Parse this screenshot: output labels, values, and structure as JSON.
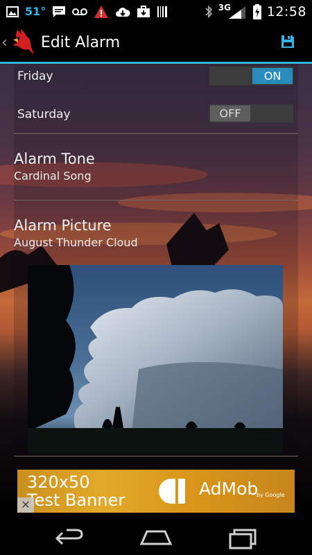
{
  "status_bar": {
    "temperature": "51°",
    "network": "3G",
    "time": "12:58",
    "icons": [
      "image-icon",
      "chat-icon",
      "voicemail-icon",
      "warning-icon",
      "cloud-download-icon",
      "briefcase-icon",
      "barcode-icon",
      "bluetooth-icon",
      "signal-icon",
      "battery-icon"
    ]
  },
  "action_bar": {
    "title": "Edit Alarm",
    "back_icon": "chevron-left-icon",
    "app_icon": "cardinal-bird-icon",
    "save_icon": "floppy-save-icon",
    "accent_color": "#33b5e5"
  },
  "days": [
    {
      "label": "Friday",
      "state": "ON"
    },
    {
      "label": "Saturday",
      "state": "OFF"
    }
  ],
  "alarm_tone": {
    "title": "Alarm Tone",
    "value": "Cardinal Song"
  },
  "alarm_picture": {
    "title": "Alarm Picture",
    "value": "August Thunder Cloud"
  },
  "ad_banner": {
    "text_line1": "320x50",
    "text_line2": "Test Banner",
    "brand": "AdMob",
    "brand_by": "by Google",
    "close": "✕"
  },
  "nav_bar": {
    "icons": [
      "back-icon",
      "home-icon",
      "recent-apps-icon"
    ]
  }
}
